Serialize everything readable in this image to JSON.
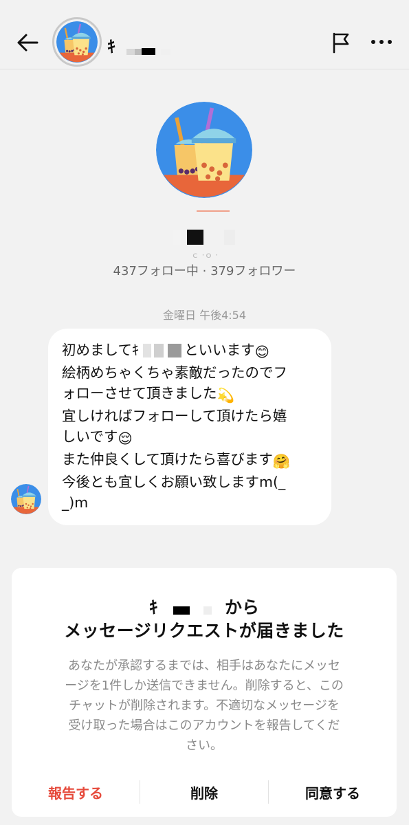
{
  "header": {
    "back_icon": "arrow-left-icon",
    "name_initial": "ｷ",
    "flag_icon": "flag-icon",
    "more_icon": "more-horizontal-icon"
  },
  "profile": {
    "sub_fragment": "ｃ ·ｏ ·",
    "stats": "437フォロー中 · 379フォロワー"
  },
  "conversation": {
    "timestamp": "金曜日 午後4:54",
    "message": {
      "line1_a": "初めまして",
      "line1_initial": "ｷ",
      "line1_b": "といいます",
      "line1_emoji": "😊",
      "line2": "絵柄めちゃくちゃ素敵だったのでフ",
      "line3": "ォローさせて頂きました",
      "line3_emoji": "💫",
      "line4": "宜しければフォローして頂けたら嬉",
      "line5": "しいです",
      "line5_emoji": "😌",
      "line6": "また仲良くして頂けたら喜びます",
      "line6_emoji": "🤗",
      "line7": "今後とも宜しくお願い致しますm(_",
      "line8": "_)m"
    }
  },
  "request_card": {
    "title_initial": "ｷ",
    "title_suffix": "から",
    "title_line2": "メッセージリクエストが届きました",
    "body_lines": [
      "あなたが承認するまでは、相手はあなたにメッセ",
      "ージを1件しか送信できません。削除すると、この",
      "チャットが削除されます。不適切なメッセージを",
      "受け取った場合はこのアカウントを報告してくだ",
      "さい。"
    ],
    "actions": {
      "report": "報告する",
      "delete": "削除",
      "accept": "同意する"
    }
  },
  "colors": {
    "background": "#f2f2f2",
    "report_red": "#e64a3b",
    "avatar_blue": "#3b8ee8",
    "avatar_orange": "#e8663a"
  }
}
